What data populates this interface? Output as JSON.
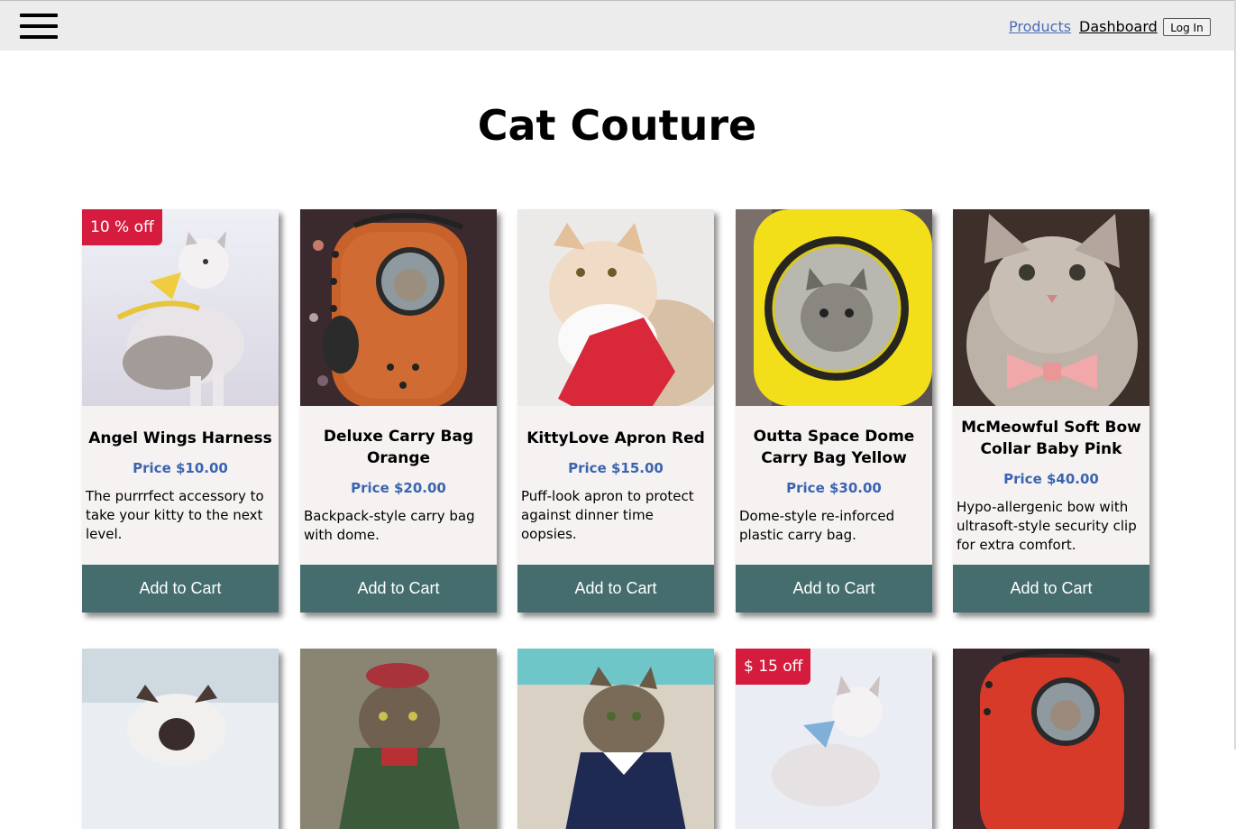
{
  "nav": {
    "products": "Products",
    "dashboard": "Dashboard",
    "login": "Log In"
  },
  "page": {
    "title": "Cat Couture"
  },
  "products": [
    {
      "name": "Angel Wings Harness",
      "price": "Price $10.00",
      "description": "The purrrfect accessory to take your kitty to the next level.",
      "badge": "10 % off",
      "button": "Add to Cart"
    },
    {
      "name": "Deluxe Carry Bag Orange",
      "price": "Price $20.00",
      "description": "Backpack-style carry bag with dome.",
      "button": "Add to Cart"
    },
    {
      "name": "KittyLove Apron Red",
      "price": "Price $15.00",
      "description": "Puff-look apron to protect against dinner time oopsies.",
      "button": "Add to Cart"
    },
    {
      "name": "Outta Space Dome Carry Bag Yellow",
      "price": "Price $30.00",
      "description": "Dome-style re-inforced plastic carry bag.",
      "button": "Add to Cart"
    },
    {
      "name": "McMeowful Soft Bow Collar Baby Pink",
      "price": "Price $40.00",
      "description": "Hypo-allergenic bow with ultrasoft-style security clip for extra comfort.",
      "button": "Add to Cart"
    }
  ],
  "products_row2": [
    {
      "badge": ""
    },
    {
      "badge": ""
    },
    {
      "badge": ""
    },
    {
      "badge": "$ 15 off"
    },
    {
      "badge": ""
    }
  ]
}
